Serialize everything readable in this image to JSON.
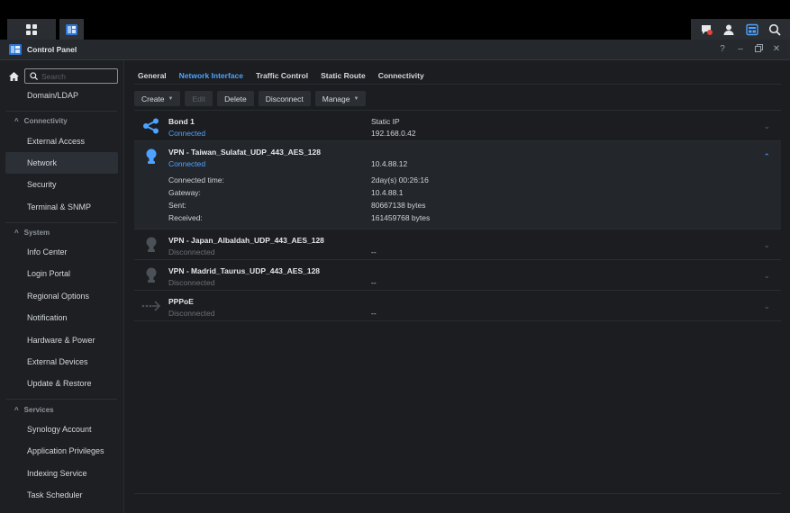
{
  "window": {
    "title": "Control Panel"
  },
  "search": {
    "placeholder": "Search"
  },
  "sidebar": {
    "items_top": [
      {
        "label": "Domain/LDAP"
      }
    ],
    "sections": [
      {
        "label": "Connectivity",
        "items": [
          "External Access",
          "Network",
          "Security",
          "Terminal & SNMP"
        ]
      },
      {
        "label": "System",
        "items": [
          "Info Center",
          "Login Portal",
          "Regional Options",
          "Notification",
          "Hardware & Power",
          "External Devices",
          "Update & Restore"
        ]
      },
      {
        "label": "Services",
        "items": [
          "Synology Account",
          "Application Privileges",
          "Indexing Service",
          "Task Scheduler"
        ]
      }
    ]
  },
  "tabs": [
    "General",
    "Network Interface",
    "Traffic Control",
    "Static Route",
    "Connectivity"
  ],
  "toolbar": {
    "create": "Create",
    "edit": "Edit",
    "delete": "Delete",
    "disconnect": "Disconnect",
    "manage": "Manage"
  },
  "interfaces": [
    {
      "name": "Bond 1",
      "status": "Connected",
      "col_a": "Static IP",
      "col_b": "192.168.0.42"
    },
    {
      "name": "VPN - Taiwan_Sulafat_UDP_443_AES_128",
      "status": "Connected",
      "col_b": "10.4.88.12",
      "details": [
        {
          "label": "Connected time:",
          "value": "2day(s) 00:26:16"
        },
        {
          "label": "Gateway:",
          "value": "10.4.88.1"
        },
        {
          "label": "Sent:",
          "value": "80667138 bytes"
        },
        {
          "label": "Received:",
          "value": "161459768 bytes"
        }
      ]
    },
    {
      "name": "VPN - Japan_Albaldah_UDP_443_AES_128",
      "status": "Disconnected",
      "col_b": "--"
    },
    {
      "name": "VPN - Madrid_Taurus_UDP_443_AES_128",
      "status": "Disconnected",
      "col_b": "--"
    },
    {
      "name": "PPPoE",
      "status": "Disconnected",
      "col_b": "--"
    }
  ],
  "colors": {
    "accent": "#4da3ff",
    "background": "#1b1d20",
    "sidebar": "#1d1f22"
  }
}
